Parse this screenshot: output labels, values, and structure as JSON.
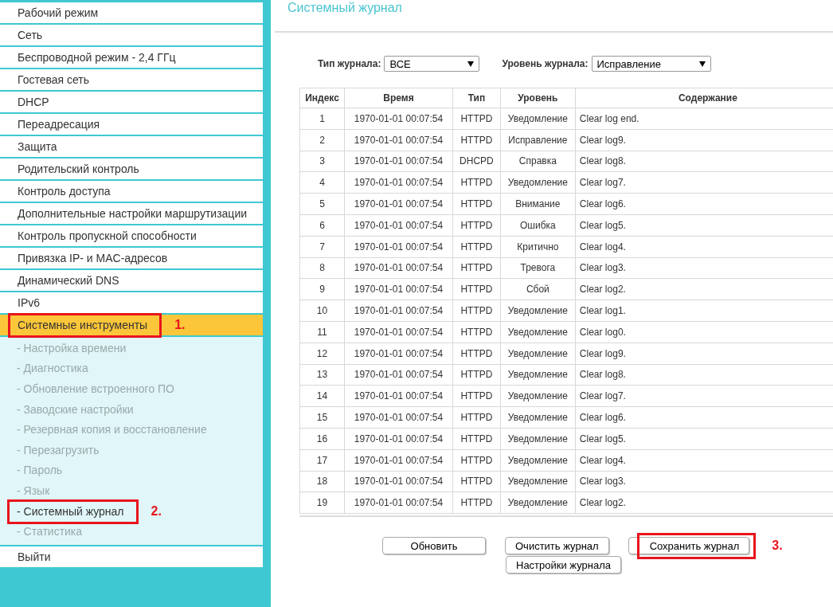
{
  "sidebar": {
    "items": [
      {
        "label": "Рабочий режим",
        "selected": false
      },
      {
        "label": "Сеть",
        "selected": false
      },
      {
        "label": "Беспроводной режим - 2,4 ГГц",
        "selected": false
      },
      {
        "label": "Гостевая сеть",
        "selected": false
      },
      {
        "label": "DHCP",
        "selected": false
      },
      {
        "label": "Переадресация",
        "selected": false
      },
      {
        "label": "Защита",
        "selected": false
      },
      {
        "label": "Родительский контроль",
        "selected": false
      },
      {
        "label": "Контроль доступа",
        "selected": false
      },
      {
        "label": "Дополнительные настройки маршрутизации",
        "selected": false
      },
      {
        "label": "Контроль пропускной способности",
        "selected": false
      },
      {
        "label": "Привязка IP- и MAC-адресов",
        "selected": false
      },
      {
        "label": "Динамический DNS",
        "selected": false
      },
      {
        "label": "IPv6",
        "selected": false
      },
      {
        "label": "Системные инструменты",
        "selected": true,
        "callout": "1.",
        "children": [
          {
            "label": "- Настройка времени",
            "selected": false
          },
          {
            "label": "- Диагностика",
            "selected": false
          },
          {
            "label": "- Обновление встроенного ПО",
            "selected": false
          },
          {
            "label": "- Заводские настройки",
            "selected": false
          },
          {
            "label": "- Резервная копия и восстановление",
            "selected": false
          },
          {
            "label": "- Перезагрузить",
            "selected": false
          },
          {
            "label": "- Пароль",
            "selected": false
          },
          {
            "label": "- Язык",
            "selected": false
          },
          {
            "label": "- Системный журнал",
            "selected": true,
            "callout": "2."
          },
          {
            "label": "- Статистика",
            "selected": false
          }
        ]
      },
      {
        "label": "Выйти",
        "selected": false
      }
    ]
  },
  "page": {
    "title": "Системный журнал"
  },
  "filters": [
    {
      "label": "Тип журнала:",
      "value": "ВСЕ"
    },
    {
      "label": "Уровень журнала:",
      "value": "Исправление"
    }
  ],
  "table": {
    "columns": [
      "Индекс",
      "Время",
      "Тип",
      "Уровень",
      "Содержание"
    ],
    "rows": [
      [
        "1",
        "1970-01-01 00:07:54",
        "HTTPD",
        "Уведомление",
        "Clear log end."
      ],
      [
        "2",
        "1970-01-01 00:07:54",
        "HTTPD",
        "Исправление",
        "Clear log9."
      ],
      [
        "3",
        "1970-01-01 00:07:54",
        "DHCPD",
        "Справка",
        "Clear log8."
      ],
      [
        "4",
        "1970-01-01 00:07:54",
        "HTTPD",
        "Уведомление",
        "Clear log7."
      ],
      [
        "5",
        "1970-01-01 00:07:54",
        "HTTPD",
        "Внимание",
        "Clear log6."
      ],
      [
        "6",
        "1970-01-01 00:07:54",
        "HTTPD",
        "Ошибка",
        "Clear log5."
      ],
      [
        "7",
        "1970-01-01 00:07:54",
        "HTTPD",
        "Критично",
        "Clear log4."
      ],
      [
        "8",
        "1970-01-01 00:07:54",
        "HTTPD",
        "Тревога",
        "Clear log3."
      ],
      [
        "9",
        "1970-01-01 00:07:54",
        "HTTPD",
        "Сбой",
        "Clear log2."
      ],
      [
        "10",
        "1970-01-01 00:07:54",
        "HTTPD",
        "Уведомление",
        "Clear log1."
      ],
      [
        "11",
        "1970-01-01 00:07:54",
        "HTTPD",
        "Уведомление",
        "Clear log0."
      ],
      [
        "12",
        "1970-01-01 00:07:54",
        "HTTPD",
        "Уведомление",
        "Clear log9."
      ],
      [
        "13",
        "1970-01-01 00:07:54",
        "HTTPD",
        "Уведомление",
        "Clear log8."
      ],
      [
        "14",
        "1970-01-01 00:07:54",
        "HTTPD",
        "Уведомление",
        "Clear log7."
      ],
      [
        "15",
        "1970-01-01 00:07:54",
        "HTTPD",
        "Уведомление",
        "Clear log6."
      ],
      [
        "16",
        "1970-01-01 00:07:54",
        "HTTPD",
        "Уведомление",
        "Clear log5."
      ],
      [
        "17",
        "1970-01-01 00:07:54",
        "HTTPD",
        "Уведомление",
        "Clear log4."
      ],
      [
        "18",
        "1970-01-01 00:07:54",
        "HTTPD",
        "Уведомление",
        "Clear log3."
      ],
      [
        "19",
        "1970-01-01 00:07:54",
        "HTTPD",
        "Уведомление",
        "Clear log2."
      ]
    ]
  },
  "button_rows": [
    [
      {
        "label": "Обновить"
      },
      {
        "label": "Очистить журнал"
      },
      {
        "label": "Сохранить журнал",
        "callout": "3."
      }
    ],
    [
      {
        "label": "Настройки журнала"
      }
    ]
  ]
}
